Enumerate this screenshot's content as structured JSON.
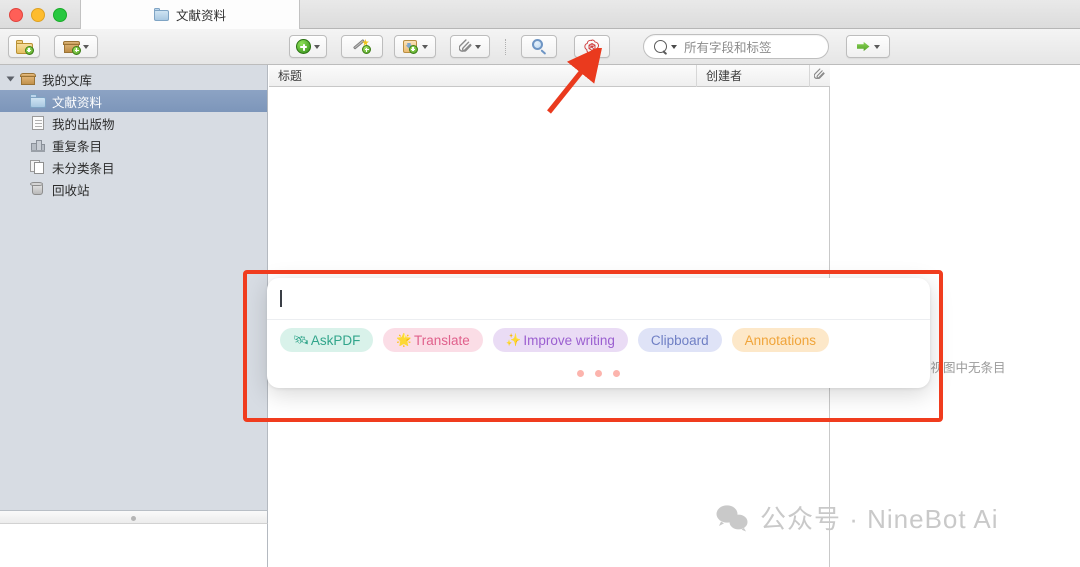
{
  "window": {
    "traffic_lights": [
      "close",
      "minimize",
      "zoom"
    ],
    "tab": {
      "label": "文献资料",
      "icon": "folder-icon"
    }
  },
  "toolbar": {
    "left_buttons": [
      {
        "name": "new-collection",
        "icon": "folder-plus-icon",
        "has_caret": false
      },
      {
        "name": "new-library",
        "icon": "box-plus-icon",
        "has_caret": true
      }
    ],
    "center_buttons": [
      {
        "name": "new-item",
        "icon": "green-plus-circle-icon",
        "has_caret": true
      },
      {
        "name": "add-by-identifier",
        "icon": "magic-wand-icon",
        "has_caret": false
      },
      {
        "name": "save-to-library",
        "icon": "save-snapshot-icon",
        "has_caret": true
      },
      {
        "name": "add-attachment",
        "icon": "paperclip-icon",
        "has_caret": true
      },
      {
        "name": "advanced-search",
        "icon": "magnifier-icon",
        "has_caret": false
      },
      {
        "name": "chatgpt-plugin",
        "icon": "openai-logo-icon",
        "has_caret": false
      }
    ],
    "search": {
      "placeholder": "所有字段和标签",
      "icon": "search-icon"
    },
    "right_button": {
      "name": "sync",
      "icon": "green-arrow-icon",
      "has_caret": true
    }
  },
  "sidebar": {
    "items": [
      {
        "label": "我的文库",
        "icon": "library-icon",
        "level": 0,
        "selected": false,
        "twisty": true
      },
      {
        "label": "文献资料",
        "icon": "folder-icon",
        "level": 1,
        "selected": true,
        "twisty": false
      },
      {
        "label": "我的出版物",
        "icon": "document-icon",
        "level": 1,
        "selected": false,
        "twisty": false
      },
      {
        "label": "重复条目",
        "icon": "duplicates-icon",
        "level": 1,
        "selected": false,
        "twisty": false
      },
      {
        "label": "未分类条目",
        "icon": "unfiled-icon",
        "level": 1,
        "selected": false,
        "twisty": false
      },
      {
        "label": "回收站",
        "icon": "trash-icon",
        "level": 1,
        "selected": false,
        "twisty": false
      }
    ]
  },
  "item_pane": {
    "columns": [
      {
        "label": "标题",
        "name": "column-title"
      },
      {
        "label": "创建者",
        "name": "column-creator"
      },
      {
        "label": "",
        "name": "column-attachment",
        "icon": "paperclip-icon"
      }
    ],
    "rows": []
  },
  "right_pane": {
    "empty_message": "当前视图中无条目"
  },
  "dialog": {
    "input_value": "",
    "chips": [
      {
        "label": "AskPDF",
        "emoji": "🛰",
        "bg": "#d9f2ea",
        "fg": "#31a58b"
      },
      {
        "label": "Translate",
        "emoji": "🌟",
        "bg": "#fbdde6",
        "fg": "#e0618c"
      },
      {
        "label": "Improve writing",
        "emoji": "✨",
        "bg": "#eadcf5",
        "fg": "#9b5fd0"
      },
      {
        "label": "Clipboard",
        "emoji": "",
        "bg": "#dfe3f7",
        "fg": "#6f7fc4"
      },
      {
        "label": "Annotations",
        "emoji": "",
        "bg": "#fde8c9",
        "fg": "#f0a43a"
      }
    ],
    "loading_dots": 3,
    "dot_color": "#fcb4ad"
  },
  "annotations": {
    "highlight_color": "#f03c1e",
    "arrow_color": "#ea3a1e",
    "arrow_target": "chatgpt-plugin"
  },
  "watermark": {
    "text": "公众号 · NineBot Ai",
    "icon": "wechat-icon",
    "color": "#c9c9c9"
  }
}
